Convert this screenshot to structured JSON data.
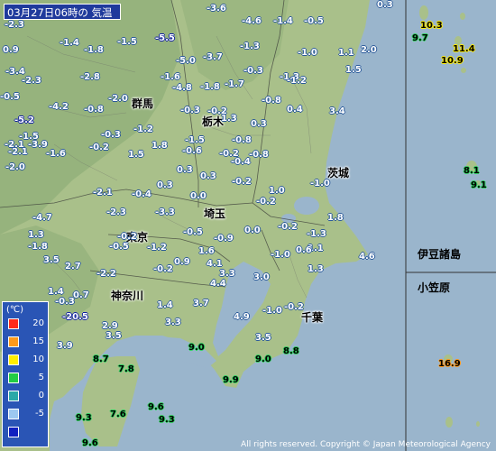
{
  "title": "03月27日06時の 気温",
  "copyright": "All rights reserved. Copyright © Japan Meteorological Agency",
  "prefectures": [
    "群馬",
    "栃木",
    "茨城",
    "埼玉",
    "東京",
    "神奈川",
    "千葉"
  ],
  "regions": [
    "伊豆諸島",
    "小笠原"
  ],
  "legend": {
    "unit": "(℃)",
    "items": [
      {
        "label": "20",
        "color": "#ff2a1a"
      },
      {
        "label": "15",
        "color": "#ff9a1a"
      },
      {
        "label": "10",
        "color": "#ffee00"
      },
      {
        "label": "5",
        "color": "#22cc44"
      },
      {
        "label": "0",
        "color": "#2aa8a8"
      },
      {
        "label": "-5",
        "color": "#9cc8f0"
      },
      {
        "label": "",
        "color": "#1020c0"
      }
    ]
  },
  "temperatures": [
    {
      "v": "-3.6",
      "c": "lightblue"
    },
    {
      "v": "-4.6",
      "c": "lightblue"
    },
    {
      "v": "-1.4",
      "c": "lightblue"
    },
    {
      "v": "-0.5",
      "c": "lightblue"
    },
    {
      "v": "0.3",
      "c": "lightblue"
    },
    {
      "v": "-2.3",
      "c": "lightblue"
    },
    {
      "v": "-5.5",
      "c": "blue"
    },
    {
      "v": "-1.3",
      "c": "lightblue"
    },
    {
      "v": "-1.0",
      "c": "lightblue"
    },
    {
      "v": "1.1",
      "c": "lightblue"
    },
    {
      "v": "2.0",
      "c": "lightblue"
    },
    {
      "v": "0.9",
      "c": "lightblue"
    },
    {
      "v": "-1.4",
      "c": "lightblue"
    },
    {
      "v": "-1.8",
      "c": "lightblue"
    },
    {
      "v": "-1.5",
      "c": "lightblue"
    },
    {
      "v": "-5.0",
      "c": "lightblue"
    },
    {
      "v": "-3.7",
      "c": "lightblue"
    },
    {
      "v": "-0.3",
      "c": "lightblue"
    },
    {
      "v": "1.5",
      "c": "lightblue"
    },
    {
      "v": "-1.3",
      "c": "lightblue"
    },
    {
      "v": "-3.4",
      "c": "lightblue"
    },
    {
      "v": "-2.3",
      "c": "lightblue"
    },
    {
      "v": "-2.8",
      "c": "lightblue"
    },
    {
      "v": "-1.6",
      "c": "lightblue"
    },
    {
      "v": "-4.8",
      "c": "lightblue"
    },
    {
      "v": "-1.8",
      "c": "lightblue"
    },
    {
      "v": "-1.7",
      "c": "lightblue"
    },
    {
      "v": "-1.2",
      "c": "lightblue"
    },
    {
      "v": "-0.5",
      "c": "lightblue"
    },
    {
      "v": "-2.0",
      "c": "lightblue"
    },
    {
      "v": "-0.3",
      "c": "lightblue"
    },
    {
      "v": "-0.8",
      "c": "lightblue"
    },
    {
      "v": "-4.2",
      "c": "lightblue"
    },
    {
      "v": "-0.8",
      "c": "lightblue"
    },
    {
      "v": "-1.2",
      "c": "lightblue"
    },
    {
      "v": "-0.2",
      "c": "lightblue"
    },
    {
      "v": "0.4",
      "c": "lightblue"
    },
    {
      "v": "3.4",
      "c": "lightblue"
    },
    {
      "v": "-5.2",
      "c": "blue"
    },
    {
      "v": "1.3",
      "c": "lightblue"
    },
    {
      "v": "0.3",
      "c": "lightblue"
    },
    {
      "v": "-2.1",
      "c": "lightblue"
    },
    {
      "v": "-1.5",
      "c": "lightblue"
    },
    {
      "v": "-0.8",
      "c": "lightblue"
    },
    {
      "v": "-1.5",
      "c": "lightblue"
    },
    {
      "v": "-2.1",
      "c": "lightblue"
    },
    {
      "v": "-0.3",
      "c": "lightblue"
    },
    {
      "v": "-3.9",
      "c": "lightblue"
    },
    {
      "v": "-0.2",
      "c": "lightblue"
    },
    {
      "v": "1.8",
      "c": "lightblue"
    },
    {
      "v": "-0.6",
      "c": "lightblue"
    },
    {
      "v": "-0.2",
      "c": "lightblue"
    },
    {
      "v": "-0.8",
      "c": "lightblue"
    },
    {
      "v": "1.5",
      "c": "lightblue"
    },
    {
      "v": "-0.4",
      "c": "lightblue"
    },
    {
      "v": "-2.0",
      "c": "lightblue"
    },
    {
      "v": "-1.6",
      "c": "lightblue"
    },
    {
      "v": "0.3",
      "c": "lightblue"
    },
    {
      "v": "0.3",
      "c": "lightblue"
    },
    {
      "v": "-1.0",
      "c": "lightblue"
    },
    {
      "v": "-2.1",
      "c": "lightblue"
    },
    {
      "v": "-0.4",
      "c": "lightblue"
    },
    {
      "v": "0.3",
      "c": "lightblue"
    },
    {
      "v": "-0.2",
      "c": "lightblue"
    },
    {
      "v": "1.0",
      "c": "lightblue"
    },
    {
      "v": "0.0",
      "c": "lightblue"
    },
    {
      "v": "-0.2",
      "c": "lightblue"
    },
    {
      "v": "-4.7",
      "c": "lightblue"
    },
    {
      "v": "-2.3",
      "c": "lightblue"
    },
    {
      "v": "-3.3",
      "c": "lightblue"
    },
    {
      "v": "1.8",
      "c": "lightblue"
    },
    {
      "v": "-0.5",
      "c": "lightblue"
    },
    {
      "v": "0.0",
      "c": "lightblue"
    },
    {
      "v": "-0.2",
      "c": "lightblue"
    },
    {
      "v": "-1.3",
      "c": "lightblue"
    },
    {
      "v": "1.3",
      "c": "lightblue"
    },
    {
      "v": "-0.2",
      "c": "lightblue"
    },
    {
      "v": "-0.9",
      "c": "lightblue"
    },
    {
      "v": "1.1",
      "c": "lightblue"
    },
    {
      "v": "-1.8",
      "c": "lightblue"
    },
    {
      "v": "-0.5",
      "c": "lightblue"
    },
    {
      "v": "-1.2",
      "c": "lightblue"
    },
    {
      "v": "1.6",
      "c": "lightblue"
    },
    {
      "v": "-1.0",
      "c": "lightblue"
    },
    {
      "v": "0.6",
      "c": "lightblue"
    },
    {
      "v": "4.6",
      "c": "lightblue"
    },
    {
      "v": "3.5",
      "c": "lightblue"
    },
    {
      "v": "2.7",
      "c": "lightblue"
    },
    {
      "v": "-0.2",
      "c": "lightblue"
    },
    {
      "v": "0.9",
      "c": "lightblue"
    },
    {
      "v": "4.1",
      "c": "lightblue"
    },
    {
      "v": "-2.2",
      "c": "lightblue"
    },
    {
      "v": "3.3",
      "c": "lightblue"
    },
    {
      "v": "3.0",
      "c": "lightblue"
    },
    {
      "v": "1.3",
      "c": "lightblue"
    },
    {
      "v": "1.4",
      "c": "lightblue"
    },
    {
      "v": "0.7",
      "c": "lightblue"
    },
    {
      "v": "4.4",
      "c": "lightblue"
    },
    {
      "v": "-0.3",
      "c": "lightblue"
    },
    {
      "v": "1.4",
      "c": "lightblue"
    },
    {
      "v": "3.7",
      "c": "lightblue"
    },
    {
      "v": "-1.0",
      "c": "lightblue"
    },
    {
      "v": "-0.2",
      "c": "lightblue"
    },
    {
      "v": "-20.5",
      "c": "blue"
    },
    {
      "v": "4.9",
      "c": "lightblue"
    },
    {
      "v": "2.9",
      "c": "lightblue"
    },
    {
      "v": "3.3",
      "c": "lightblue"
    },
    {
      "v": "3.5",
      "c": "lightblue"
    },
    {
      "v": "3.5",
      "c": "lightblue"
    },
    {
      "v": "3.9",
      "c": "lightblue"
    },
    {
      "v": "9.0",
      "c": "green"
    },
    {
      "v": "8.8",
      "c": "green"
    },
    {
      "v": "9.0",
      "c": "green"
    },
    {
      "v": "8.7",
      "c": "green"
    },
    {
      "v": "7.8",
      "c": "green"
    },
    {
      "v": "9.9",
      "c": "green"
    },
    {
      "v": "9.6",
      "c": "green"
    },
    {
      "v": "7.6",
      "c": "green"
    },
    {
      "v": "9.3",
      "c": "green"
    },
    {
      "v": "9.3",
      "c": "green"
    },
    {
      "v": "9.6",
      "c": "green"
    },
    {
      "v": "10.3",
      "c": "yellow"
    },
    {
      "v": "9.7",
      "c": "green"
    },
    {
      "v": "11.4",
      "c": "yellow"
    },
    {
      "v": "10.9",
      "c": "yellow"
    },
    {
      "v": "8.1",
      "c": "green"
    },
    {
      "v": "9.1",
      "c": "green"
    },
    {
      "v": "16.9",
      "c": "orange"
    }
  ]
}
